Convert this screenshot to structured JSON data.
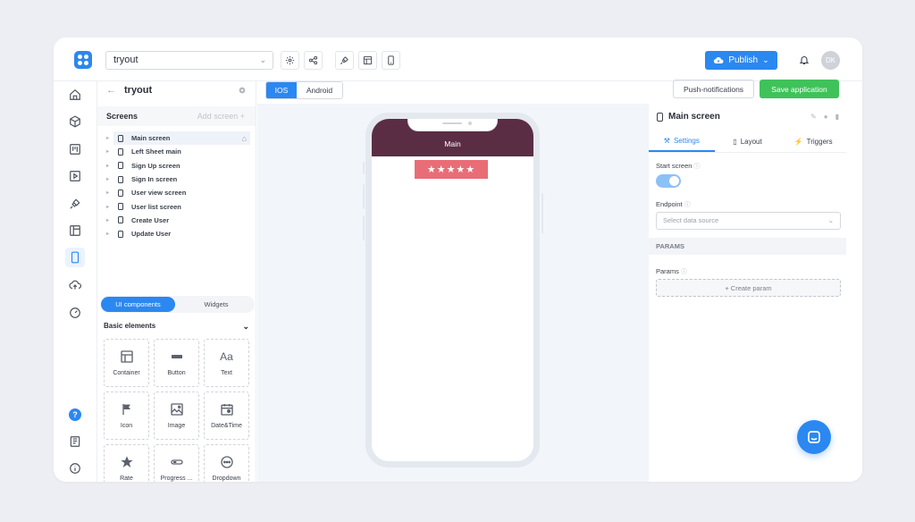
{
  "topbar": {
    "project": "tryout",
    "publish_label": "Publish",
    "avatar_initials": "DK"
  },
  "panel": {
    "title": "tryout",
    "screens_label": "Screens",
    "add_screen_label": "Add screen +",
    "screens": [
      {
        "name": "Main screen"
      },
      {
        "name": "Left Sheet main"
      },
      {
        "name": "Sign Up screen"
      },
      {
        "name": "Sign In screen"
      },
      {
        "name": "User view screen"
      },
      {
        "name": "User list screen"
      },
      {
        "name": "Create User"
      },
      {
        "name": "Update User"
      }
    ],
    "tabs": {
      "components": "UI components",
      "widgets": "Widgets"
    },
    "section_label": "Basic elements",
    "elements": [
      {
        "label": "Container",
        "icon": "container-icon"
      },
      {
        "label": "Button",
        "icon": "button-icon"
      },
      {
        "label": "Text",
        "icon": "text-icon"
      },
      {
        "label": "Icon",
        "icon": "flag-icon"
      },
      {
        "label": "Image",
        "icon": "image-icon"
      },
      {
        "label": "Date&Time",
        "icon": "calendar-icon"
      },
      {
        "label": "Rate",
        "icon": "star-icon"
      },
      {
        "label": "Progress ...",
        "icon": "progress-icon"
      },
      {
        "label": "Dropdown",
        "icon": "dropdown-icon"
      }
    ],
    "text_icon_glyph": "Aa"
  },
  "canvas": {
    "os_ios": "IOS",
    "os_android": "Android",
    "phone_header": "Main",
    "rating_stars": "★★★★★"
  },
  "right": {
    "push_label": "Push-notifications",
    "save_label": "Save application",
    "screen_title": "Main screen",
    "tabs": {
      "settings": "Settings",
      "layout": "Layout",
      "triggers": "Triggers"
    },
    "start_screen_label": "Start screen",
    "start_screen_on": true,
    "endpoint_label": "Endpoint",
    "endpoint_placeholder": "Select data source",
    "params_section": "PARAMS",
    "params_label": "Params",
    "create_param": "+ Create param"
  },
  "colors": {
    "accent": "#2b88f0",
    "save_green": "#3fc25a",
    "phone_header": "#5b2d45",
    "rating_bg": "#e96d76"
  }
}
